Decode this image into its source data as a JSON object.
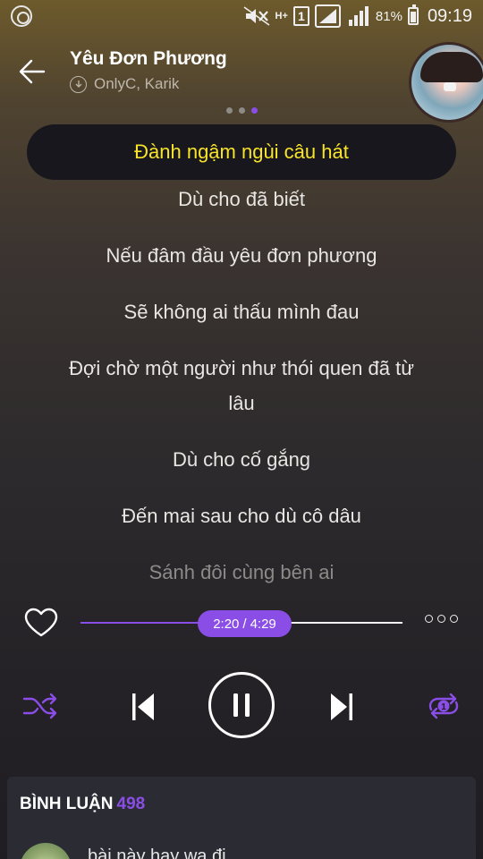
{
  "status_bar": {
    "network": "H+",
    "sim_slot": "1",
    "battery_percent": "81%",
    "time": "09:19"
  },
  "header": {
    "song_title": "Yêu Đơn Phương",
    "artists": "OnlyC, Karik"
  },
  "pager": {
    "total": 3,
    "active": 3
  },
  "lyrics": {
    "current": "Đành ngậm ngùi câu hát",
    "lines": [
      "Dù cho đã biết",
      "Nếu đâm đầu yêu đơn phương",
      "Sẽ không ai thấu mình đau",
      "Đợi chờ một người như thói quen đã từ",
      "lâu",
      "Dù cho cố gắng",
      "Đến mai sau cho dù cô dâu",
      "Sánh đôi cùng bên ai"
    ]
  },
  "player": {
    "elapsed": "2:20",
    "separator": "/",
    "duration": "4:29",
    "progress_fraction": 0.52,
    "repeat_badge": "1"
  },
  "comments": {
    "title": "BÌNH LUẬN",
    "count": "498",
    "first_comment": "bài này hay wa đi"
  },
  "colors": {
    "accent": "#8a4ee6",
    "current_lyric": "#f8e42a"
  }
}
